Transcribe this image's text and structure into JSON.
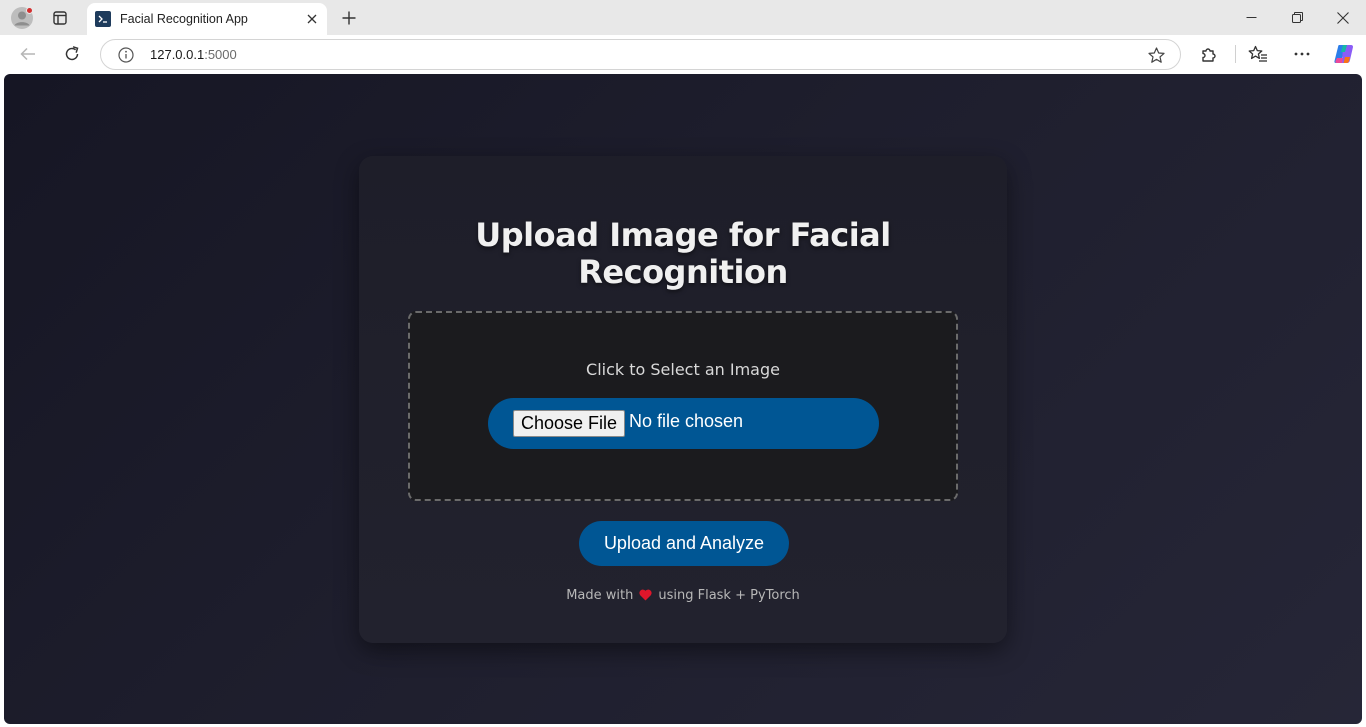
{
  "browser": {
    "tab_title": "Facial Recognition App",
    "url_host": "127.0.0.1",
    "url_port": ":5000"
  },
  "page": {
    "heading_line1": "Upload Image for Facial",
    "heading_line2": "Recognition",
    "select_prompt": "Click to Select an Image",
    "choose_file_label": "Choose File",
    "no_file_text": "No file chosen",
    "upload_button_label": "Upload and Analyze",
    "footer_before": "Made with",
    "footer_after": "using Flask + PyTorch"
  },
  "colors": {
    "accent": "#005694",
    "page_bg": "#1e1e2d",
    "card_bg": "#22222e",
    "heart": "#e0162b"
  },
  "icons": {
    "profile": "profile-icon",
    "tab_actions": "tab-actions-icon",
    "favicon": "terminal-favicon",
    "tab_close": "close-icon",
    "new_tab": "plus-icon",
    "back": "back-arrow-icon",
    "refresh": "refresh-icon",
    "info": "info-icon",
    "favorite": "star-icon",
    "extensions": "puzzle-icon",
    "favorites": "favorites-icon",
    "menu": "more-icon",
    "copilot": "copilot-icon"
  }
}
